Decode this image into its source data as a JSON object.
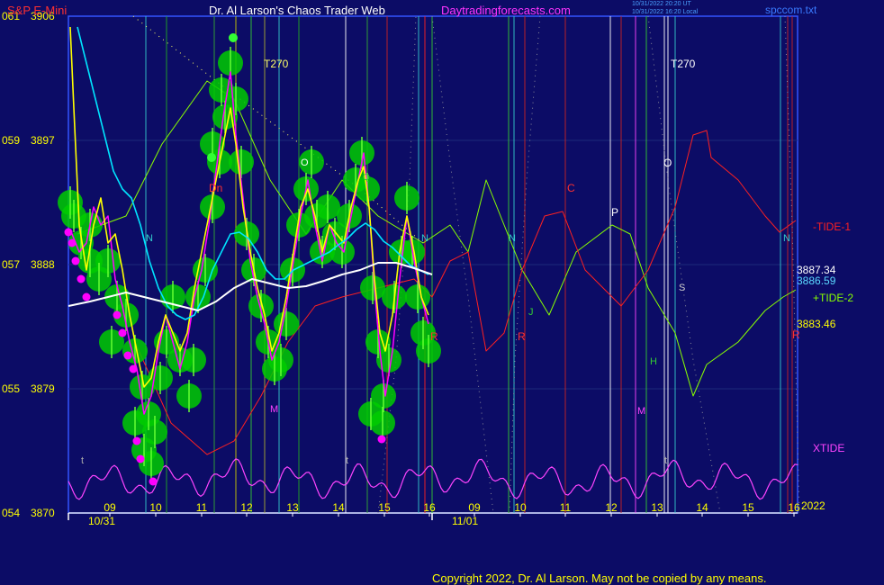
{
  "header": {
    "symbol": "S&P E-Mini",
    "title": "Dr. Al Larson's Chaos Trader Web",
    "site": "Daytradingforecasts.com",
    "timestamp_1": "10/31/2022 20:20 UT",
    "timestamp_2": "10/31/2022 16:20 Local",
    "file": "spccom.txt"
  },
  "copyright": "Copyright 2022, Dr. Al Larson. May not be copied by any means.",
  "colors": {
    "background": "#0c0c66",
    "price_yellow": "#ffff00",
    "magenta": "#ff00ff",
    "cyan": "#00e5ff",
    "white": "#ffffff",
    "red": "#ff2020",
    "green": "#33ff33",
    "tide2": "#88ff00",
    "tide1": "#ff2020",
    "xtide": "#ff44ff",
    "flower": "#00cc00"
  },
  "chart_data": {
    "type": "line",
    "ylim": [
      3870,
      3906
    ],
    "y_ticks": [
      {
        "code": "061",
        "price": "3906",
        "v": 3906
      },
      {
        "code": "059",
        "price": "3897",
        "v": 3897
      },
      {
        "code": "057",
        "price": "3888",
        "v": 3888
      },
      {
        "code": "055",
        "price": "3879",
        "v": 3879
      },
      {
        "code": "054",
        "price": "3870",
        "v": 3870
      }
    ],
    "x_tick_labels": [
      "09",
      "10",
      "11",
      "12",
      "13",
      "14",
      "15",
      "16",
      "09",
      "10",
      "11",
      "12",
      "13",
      "14",
      "15",
      "16"
    ],
    "date_labels": [
      "10/31",
      "11/01"
    ],
    "year_label": "2022",
    "series": [
      {
        "name": "-TIDE-1"
      },
      {
        "name": "+TIDE-2"
      },
      {
        "name": "XTIDE"
      }
    ],
    "value_labels": [
      {
        "text": "3887.34",
        "color": "#ffffff"
      },
      {
        "text": "3886.59",
        "color": "#5ad8ff"
      },
      {
        "text": "3883.46",
        "color": "#ffff00"
      }
    ],
    "annotations": [
      "T270",
      "T270",
      "N",
      "N",
      "N",
      "N",
      "Q",
      "O",
      "P",
      "C",
      "R",
      "R",
      "R",
      "J",
      "H",
      "M",
      "M",
      "S",
      "Dn",
      "O",
      "t",
      "t",
      "t"
    ]
  }
}
